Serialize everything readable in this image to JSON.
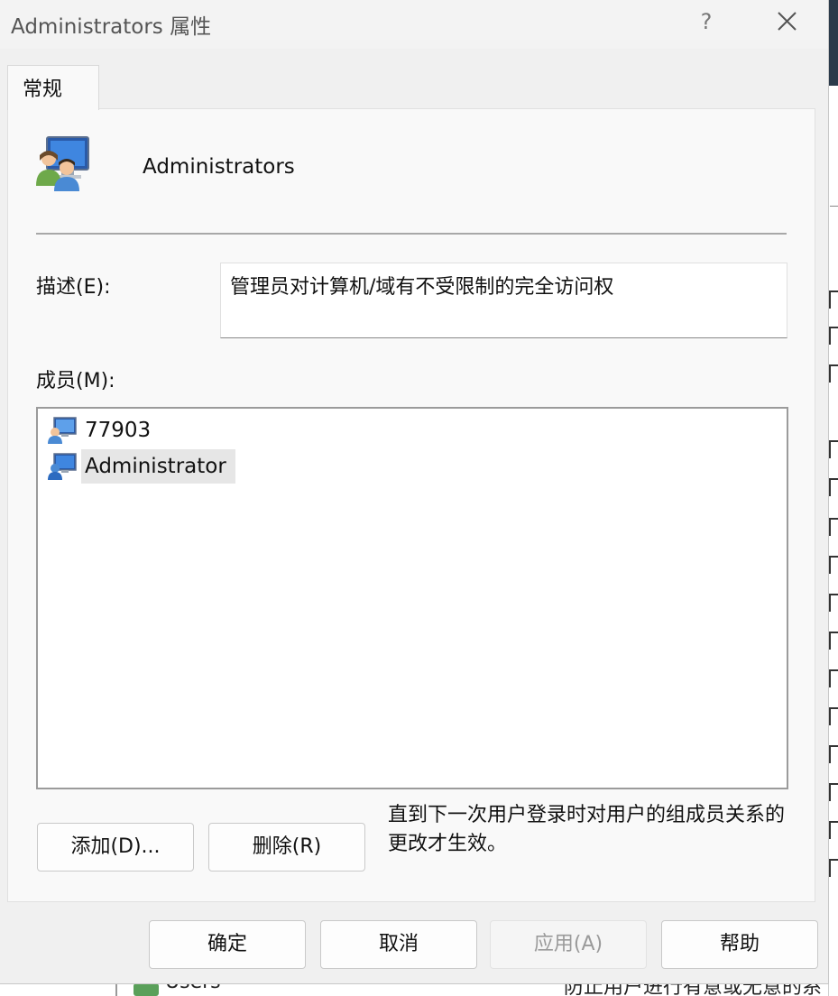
{
  "window": {
    "title": "Administrators 属性",
    "help_label": "?",
    "close_icon": "close-icon"
  },
  "tabs": [
    {
      "label": "常规",
      "active": true
    }
  ],
  "group": {
    "icon": "user-group-icon",
    "name": "Administrators"
  },
  "description": {
    "label": "描述(E):",
    "value": "管理员对计算机/域有不受限制的完全访问权"
  },
  "members": {
    "label": "成员(M):",
    "items": [
      {
        "name": "77903",
        "icon": "local-user-computer-icon",
        "selected": false
      },
      {
        "name": "Administrator",
        "icon": "domain-user-computer-icon",
        "selected": true
      }
    ]
  },
  "actions": {
    "add_label": "添加(D)...",
    "remove_label": "删除(R)"
  },
  "note": "直到下一次用户登录时对用户的组成员关系的更改才生效。",
  "footer": {
    "ok_label": "确定",
    "cancel_label": "取消",
    "apply_label": "应用(A)",
    "apply_enabled": false,
    "help_label": "帮助"
  },
  "background_window": {
    "row_name": "Users",
    "row_description": "防止用户进行有意或无意的系"
  },
  "colors": {
    "dialog_bg": "#f0f0f0",
    "panel_bg": "#f9f9f9",
    "selection_bg": "#e6e6e6"
  }
}
